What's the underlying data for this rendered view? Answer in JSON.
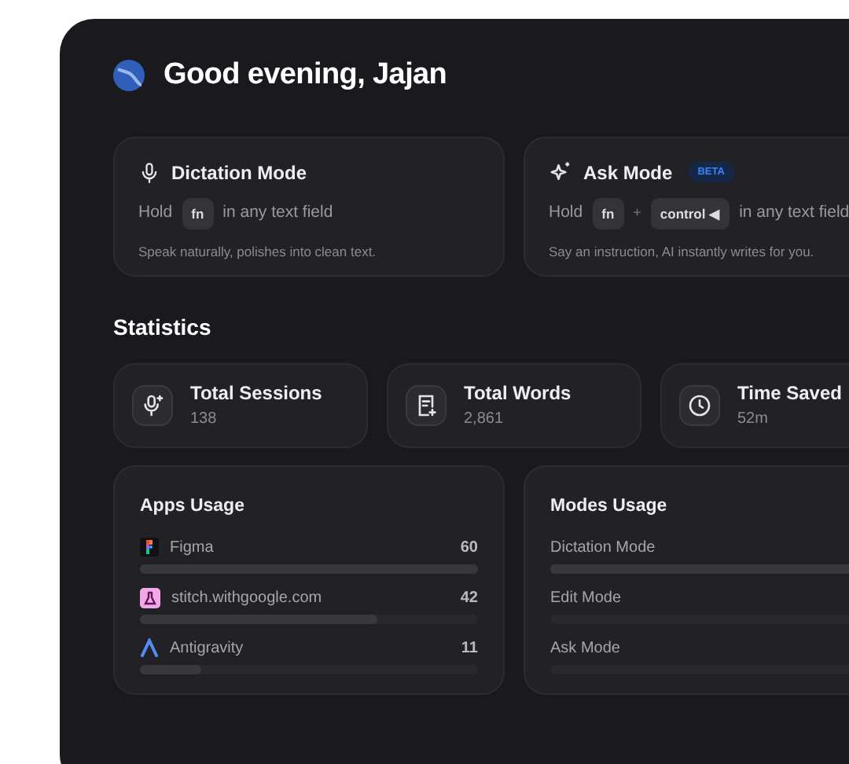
{
  "greeting": "Good evening, Jajan",
  "modes": [
    {
      "kind": "dictation",
      "title": "Dictation Mode",
      "hold": "Hold",
      "keys": [
        "fn"
      ],
      "suffix": "in any text field",
      "description": "Speak naturally, polishes into clean text."
    },
    {
      "kind": "ask",
      "title": "Ask Mode",
      "badge": "BETA",
      "hold": "Hold",
      "keys": [
        "fn",
        "control ◀"
      ],
      "plus": "+",
      "suffix": "in any text field",
      "description": "Say an instruction, AI instantly writes for you."
    }
  ],
  "statistics": {
    "title": "Statistics",
    "cards": [
      {
        "kind": "sessions",
        "label": "Total Sessions",
        "value": "138"
      },
      {
        "kind": "words",
        "label": "Total Words",
        "value": "2,861"
      },
      {
        "kind": "time",
        "label": "Time Saved",
        "value": "52m"
      }
    ]
  },
  "apps_usage": {
    "title": "Apps Usage",
    "items": [
      {
        "kind": "figma",
        "name": "Figma",
        "count": "60",
        "level": 1
      },
      {
        "kind": "stitch",
        "name": "stitch.withgoogle.com",
        "count": "42",
        "level": 0.7
      },
      {
        "kind": "antigravity",
        "name": "Antigravity",
        "count": "11",
        "level": 0.18
      }
    ]
  },
  "modes_usage": {
    "title": "Modes Usage",
    "items": [
      {
        "name": "Dictation Mode",
        "level": 1
      },
      {
        "name": "Edit Mode"
      },
      {
        "name": "Ask Mode"
      }
    ]
  }
}
